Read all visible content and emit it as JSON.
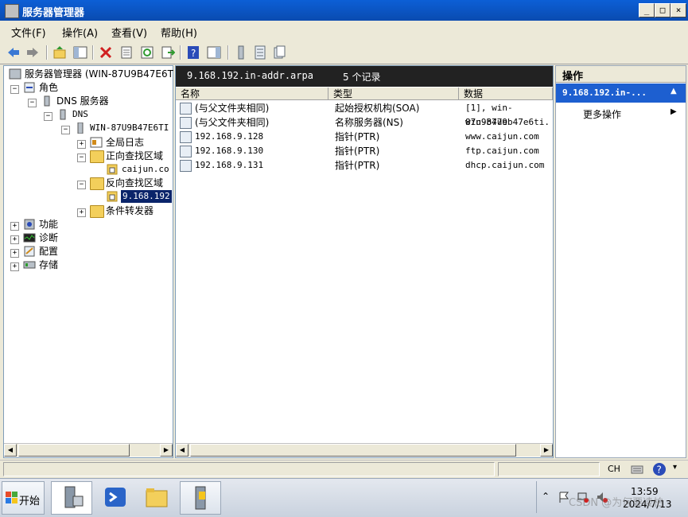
{
  "window": {
    "title": "服务器管理器"
  },
  "menu": [
    {
      "label": "文件(F)"
    },
    {
      "label": "操作(A)"
    },
    {
      "label": "查看(V)"
    },
    {
      "label": "帮助(H)"
    }
  ],
  "tree": {
    "root": "服务器管理器 (WIN-87U9B47E6T",
    "roles": "角色",
    "dns_server": "DNS 服务器",
    "dns": "DNS",
    "host": "WIN-87U9B47E6TI",
    "global_log": "全局日志",
    "forward_zone": "正向查找区域",
    "forward_child": "caijun.co",
    "reverse_zone": "反向查找区域",
    "reverse_child": "9.168.192",
    "conditional": "条件转发器",
    "features": "功能",
    "diagnostics": "诊断",
    "config": "配置",
    "storage": "存储"
  },
  "list": {
    "zone_name": "9.168.192.in-addr.arpa",
    "record_count": "5 个记录",
    "columns": [
      "名称",
      "类型",
      "数据"
    ],
    "rows": [
      {
        "name": "(与父文件夹相同)",
        "type": "起始授权机构(SOA)",
        "data": "[1], win-87u9b47e"
      },
      {
        "name": "(与父文件夹相同)",
        "type": "名称服务器(NS)",
        "data": "win-87u9b47e6ti."
      },
      {
        "name": "192.168.9.128",
        "type": "指针(PTR)",
        "data": "www.caijun.com"
      },
      {
        "name": "192.168.9.130",
        "type": "指针(PTR)",
        "data": "ftp.caijun.com"
      },
      {
        "name": "192.168.9.131",
        "type": "指针(PTR)",
        "data": "dhcp.caijun.com"
      }
    ]
  },
  "actions": {
    "header": "操作",
    "selected": "9.168.192.in-...",
    "more": "更多操作"
  },
  "taskbar": {
    "start": "开始",
    "time": "13:59",
    "date": "2024/7/13",
    "lang": "CH",
    "watermark": "CSDN @为何要凌柏"
  }
}
